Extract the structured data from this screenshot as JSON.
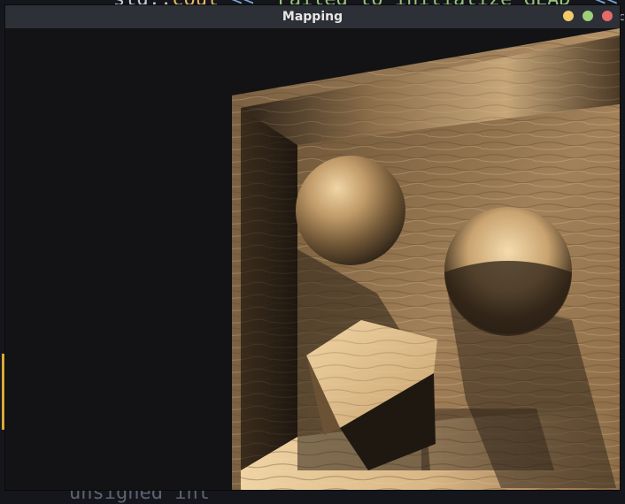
{
  "window": {
    "title": "Mapping",
    "controls": [
      "minimize",
      "maximize",
      "close"
    ],
    "colors": {
      "titlebar": "#2d3036",
      "minimize": "#f2c96b",
      "maximize": "#9ccf7a",
      "close": "#e56a6a"
    }
  },
  "editor_background": {
    "top_line": {
      "ns": "std::",
      "kw": "cout",
      "op": " << ",
      "str": "\"Failed to initialize GLAD\"",
      "tail": " << "
    },
    "bottom_line": "unsigned int"
  },
  "scene": {
    "description_icons": [
      "wood-box-room",
      "sphere",
      "sphere",
      "cube"
    ],
    "palette": {
      "wood_light": "#d9b98a",
      "wood_mid": "#a8855a",
      "wood_dark": "#5a4428",
      "shadow": "#2a2016"
    }
  }
}
